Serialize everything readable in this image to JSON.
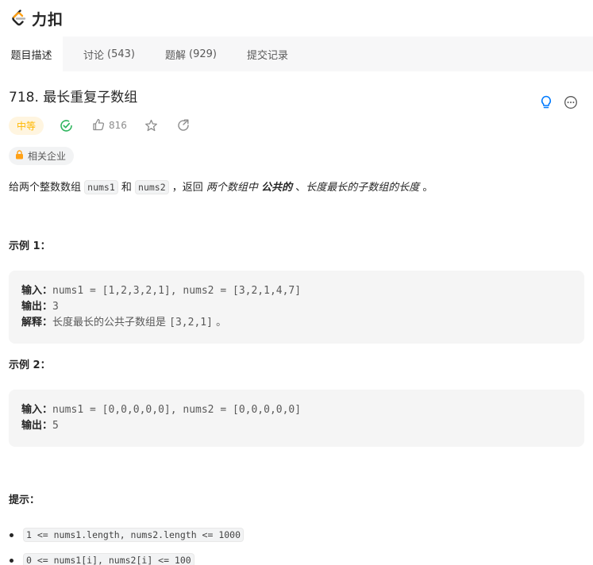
{
  "app": {
    "logo_text": "力扣"
  },
  "tabs": [
    {
      "label": "题目描述",
      "count": ""
    },
    {
      "label": "讨论",
      "count": "(543)"
    },
    {
      "label": "题解",
      "count": "(929)"
    },
    {
      "label": "提交记录",
      "count": ""
    }
  ],
  "problem": {
    "title": "718. 最长重复子数组",
    "difficulty": "中等",
    "likes": "816",
    "company_tag": "相关企业",
    "description": {
      "p1": "给两个整数数组 ",
      "c1": "nums1",
      "p2": " 和 ",
      "c2": "nums2",
      "p3": " ，返回 ",
      "e1": "两个数组中 ",
      "e2": "公共的",
      "p4": " 、",
      "e3": "长度最长的子数组的长度",
      "p5": " 。"
    }
  },
  "examples": [
    {
      "title": "示例 1：",
      "input_label": "输入：",
      "input": "nums1 = [1,2,3,2,1], nums2 = [3,2,1,4,7]",
      "output_label": "输出：",
      "output": "3",
      "explain_label": "解释：",
      "explain_text": "长度最长的公共子数组是 ",
      "explain_code": "[3,2,1]",
      "explain_end": " 。"
    },
    {
      "title": "示例 2：",
      "input_label": "输入：",
      "input": "nums1 = [0,0,0,0,0], nums2 = [0,0,0,0,0]",
      "output_label": "输出：",
      "output": "5"
    }
  ],
  "hints": {
    "title": "提示：",
    "items": [
      "1 <= nums1.length, nums2.length <= 1000",
      "0 <= nums1[i], nums2[i] <= 100"
    ]
  },
  "colors": {
    "difficulty_text": "#ffb800",
    "difficulty_bg": "#fff5e0",
    "accepted": "#2db55d",
    "hint_bulb": "#007aff",
    "logo_orange": "#ffa116"
  },
  "icons": [
    "leetcode-logo-icon",
    "lightbulb-icon",
    "more-icon",
    "accepted-check-icon",
    "thumbs-up-icon",
    "star-icon",
    "share-icon",
    "lock-icon"
  ]
}
